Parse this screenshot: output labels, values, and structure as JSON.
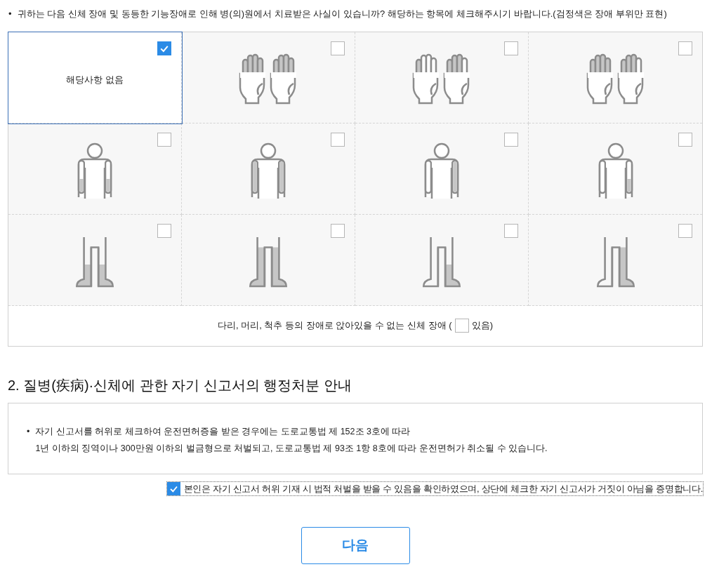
{
  "intro_bullet": "•",
  "intro": "귀하는 다음 신체 장애 및 동등한 기능장애로 인해 병(의)원에서 치료받은 사실이 있습니까? 해당하는 항목에 체크해주시기 바랍니다.(검정색은 장애 부위만 표현)",
  "grid": [
    {
      "kind": "text",
      "label": "해당사항 없음",
      "checked": true
    },
    {
      "kind": "hands",
      "checked": false
    },
    {
      "kind": "hands",
      "checked": false
    },
    {
      "kind": "hands",
      "checked": false
    },
    {
      "kind": "arms",
      "checked": false
    },
    {
      "kind": "arms",
      "checked": false
    },
    {
      "kind": "arms",
      "checked": false
    },
    {
      "kind": "arms",
      "checked": false
    },
    {
      "kind": "legs",
      "checked": false
    },
    {
      "kind": "legs",
      "checked": false
    },
    {
      "kind": "legs",
      "checked": false
    },
    {
      "kind": "legs",
      "checked": false
    }
  ],
  "sitting": {
    "before": "다리, 머리, 척추 등의 장애로 앉아있을 수 없는 신체 장애 (",
    "after": "있음)",
    "checked": false
  },
  "section": {
    "title": "2. 질병(疾病)·신체에 관한 자기 신고서의 행정처분 안내",
    "notice_bullet": "•",
    "notice": [
      "자기 신고서를 허위로 체크하여 운전면허증을 받은 경우에는 도로교통법 제 152조 3호에 따라",
      "1년 이하의 징역이나 300만원 이하의 벌금형으로 처벌되고, 도로교통법 제 93조 1항 8호에 따라 운전면허가 취소될 수 있습니다."
    ]
  },
  "confirm": {
    "label": "본인은 자기 신고서 허위 기재 시 법적 처벌을 받을 수 있음을 확인하였으며, 상단에 체크한 자기 신고서가 거짓이 아님을 증명합니다.",
    "checked": true
  },
  "next_button": "다음"
}
